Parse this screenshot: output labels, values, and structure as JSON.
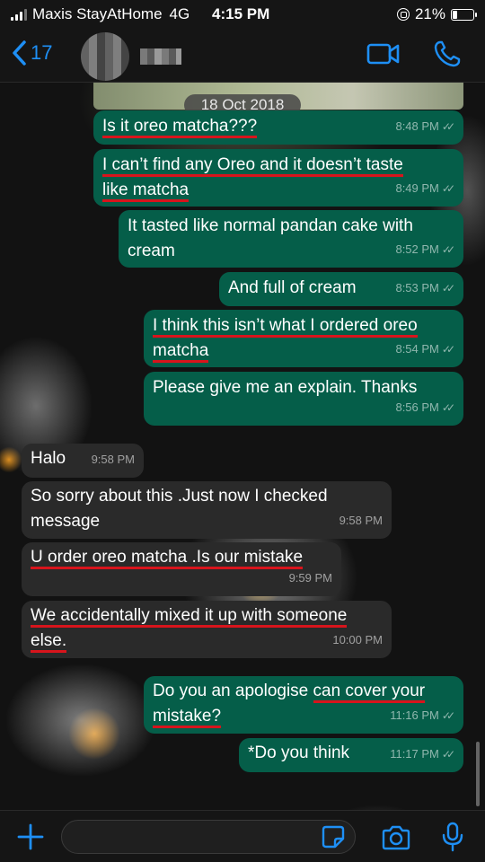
{
  "status_bar": {
    "carrier": "Maxis StayAtHome",
    "network": "4G",
    "time": "4:15 PM",
    "battery": "21%",
    "battery_level": 0.21
  },
  "header": {
    "back_count": "17",
    "contact_name_redacted": true
  },
  "date_label": "18 Oct 2018",
  "colors": {
    "accent": "#1e8ff5",
    "outgoing_bubble": "#055e49",
    "incoming_bubble": "#2a2a2a",
    "underline": "#d8141c"
  },
  "messages": [
    {
      "dir": "out",
      "text": "Is it oreo matcha???",
      "time": "8:48 PM",
      "read": true
    },
    {
      "dir": "out",
      "text_line1": "I can’t find any Oreo and it doesn’t taste",
      "text_line2": "like matcha",
      "time": "8:49 PM",
      "read": true
    },
    {
      "dir": "out",
      "text_line1": "It tasted like normal pandan cake with",
      "text_line2": "cream",
      "time": "8:52 PM",
      "read": true
    },
    {
      "dir": "out",
      "text": "And full of cream",
      "time": "8:53 PM",
      "read": true
    },
    {
      "dir": "out",
      "text_line1": "I think this isn’t what I ordered oreo",
      "text_line2": "matcha",
      "time": "8:54 PM",
      "read": true
    },
    {
      "dir": "out",
      "text": "Please give me an explain. Thanks",
      "time": "8:56 PM",
      "read": true
    },
    {
      "dir": "in",
      "text": "Halo",
      "time": "9:58 PM"
    },
    {
      "dir": "in",
      "text_line1": "So sorry about this .Just now I checked",
      "text_line2": "message",
      "time": "9:58 PM"
    },
    {
      "dir": "in",
      "text": "U order oreo matcha .Is our mistake",
      "time": "9:59 PM"
    },
    {
      "dir": "in",
      "text_line1": "We accidentally mixed it up with someone",
      "text_line2": "else.",
      "time": "10:00 PM"
    },
    {
      "dir": "out",
      "text_line1a": "Do you an apologise ",
      "text_line1b": "can cover your",
      "text_line2": "mistake?",
      "time": "11:16 PM",
      "read": true
    },
    {
      "dir": "out",
      "text": "*Do you think",
      "time": "11:17 PM",
      "read": true
    }
  ],
  "icons": {
    "back": "chevron-left-icon",
    "video": "video-camera-icon",
    "call": "phone-icon",
    "plus": "plus-icon",
    "sticker": "sticker-icon",
    "camera": "camera-icon",
    "mic": "microphone-icon"
  },
  "composer": {
    "value": "",
    "placeholder": ""
  }
}
